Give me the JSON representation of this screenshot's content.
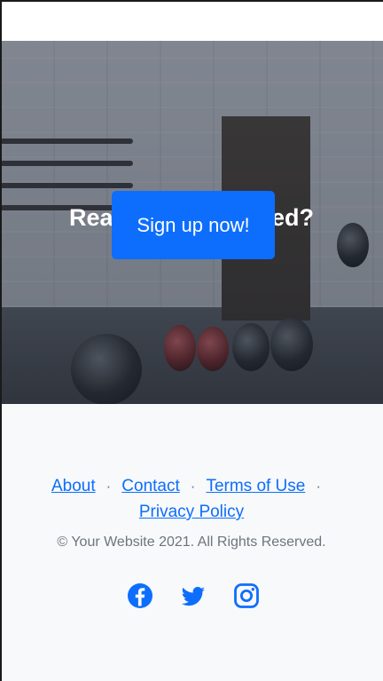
{
  "hero": {
    "title": "Ready to get started?",
    "cta_label": "Sign up now!"
  },
  "footer": {
    "links": [
      {
        "label": "About"
      },
      {
        "label": "Contact"
      },
      {
        "label": "Terms of Use"
      },
      {
        "label": "Privacy Policy"
      }
    ],
    "separator": "·",
    "copyright": "© Your Website 2021. All Rights Reserved.",
    "socials": [
      {
        "icon": "facebook-icon"
      },
      {
        "icon": "twitter-icon"
      },
      {
        "icon": "instagram-icon"
      }
    ]
  },
  "colors": {
    "primary": "#0d6efd",
    "footer_bg": "#f8f9fa",
    "muted_text": "#6c757d"
  }
}
